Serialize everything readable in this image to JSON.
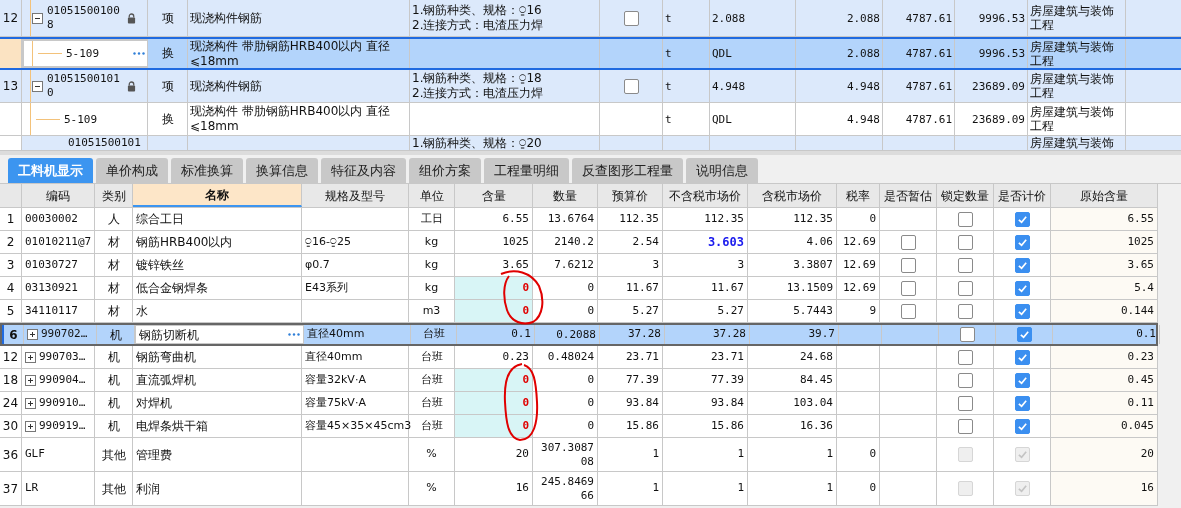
{
  "bill_rows": [
    {
      "kind": "item",
      "index": "12",
      "code": "010515001008",
      "locked": true,
      "expanded": true,
      "type": "项",
      "name": "现浇构件钢筋",
      "features": [
        "1.钢筋种类、规格：⍜16",
        "2.连接方式：电渣压力焊"
      ],
      "checked": false,
      "unit": "t",
      "expression": "2.088",
      "quantity": "2.088",
      "unit_price": "4787.61",
      "total": "9996.53",
      "specialty": "房屋建筑与装饰工程",
      "selected": false
    },
    {
      "kind": "sub",
      "code": "5-109",
      "type": "换",
      "name": "现浇构件 带肋钢筋HRB400以内 直径⩽18mm",
      "unit": "t",
      "expression": "QDL",
      "quantity": "2.088",
      "unit_price": "4787.61",
      "total": "9996.53",
      "specialty": "房屋建筑与装饰工程",
      "selected": true
    },
    {
      "kind": "item",
      "index": "13",
      "code": "010515001010",
      "locked": true,
      "expanded": true,
      "type": "项",
      "name": "现浇构件钢筋",
      "features": [
        "1.钢筋种类、规格：⍜18",
        "2.连接方式：电渣压力焊"
      ],
      "checked": false,
      "unit": "t",
      "expression": "4.948",
      "quantity": "4.948",
      "unit_price": "4787.61",
      "total": "23689.09",
      "specialty": "房屋建筑与装饰工程",
      "selected": false
    },
    {
      "kind": "sub",
      "code": "5-109",
      "type": "换",
      "name": "现浇构件 带肋钢筋HRB400以内 直径⩽18mm",
      "unit": "t",
      "expression": "QDL",
      "quantity": "4.948",
      "unit_price": "4787.61",
      "total": "23689.09",
      "specialty": "房屋建筑与装饰工程",
      "selected": false
    },
    {
      "kind": "partial",
      "code": "01051500101",
      "features": [
        "1.钢筋种类、规格：⍜20"
      ],
      "specialty": "房屋建筑与装饰"
    }
  ],
  "tabs": [
    {
      "label": "工料机显示",
      "selected": true
    },
    {
      "label": "单价构成",
      "selected": false
    },
    {
      "label": "标准换算",
      "selected": false
    },
    {
      "label": "换算信息",
      "selected": false
    },
    {
      "label": "特征及内容",
      "selected": false
    },
    {
      "label": "组价方案",
      "selected": false
    },
    {
      "label": "工程量明细",
      "selected": false
    },
    {
      "label": "反查图形工程量",
      "selected": false
    },
    {
      "label": "说明信息",
      "selected": false
    }
  ],
  "columns": [
    {
      "label": "编码",
      "active": false
    },
    {
      "label": "类别",
      "active": false
    },
    {
      "label": "名称",
      "active": true
    },
    {
      "label": "规格及型号",
      "active": false
    },
    {
      "label": "单位",
      "active": false
    },
    {
      "label": "含量",
      "active": false
    },
    {
      "label": "数量",
      "active": false
    },
    {
      "label": "预算价",
      "active": false
    },
    {
      "label": "不含税市场价",
      "active": false
    },
    {
      "label": "含税市场价",
      "active": false
    },
    {
      "label": "税率",
      "active": false
    },
    {
      "label": "是否暂估",
      "active": false
    },
    {
      "label": "锁定数量",
      "active": false
    },
    {
      "label": "是否计价",
      "active": false
    },
    {
      "label": "原始含量",
      "active": false
    }
  ],
  "resources": [
    {
      "index": "1",
      "code": "00030002",
      "expandable": false,
      "type": "人",
      "name": "综合工日",
      "unit": "工日",
      "content": "6.55",
      "content_changed": false,
      "quantity": "13.6764",
      "budget_price": "112.35",
      "market_price": "112.35",
      "market_price_adjusted": false,
      "tax_price": "112.35",
      "tax_rate": "0",
      "locked": false,
      "priced": true,
      "disabled": false,
      "original_content": "6.55",
      "selected": false
    },
    {
      "index": "2",
      "code": "01010211@7",
      "expandable": false,
      "type": "材",
      "name": "钢筋HRB400以内",
      "spec": "⍜16-⍜25",
      "unit": "kg",
      "content": "1025",
      "content_changed": false,
      "quantity": "2140.2",
      "budget_price": "2.54",
      "market_price": "3.603",
      "market_price_adjusted": true,
      "tax_price": "4.06",
      "tax_rate": "12.69",
      "provisional": false,
      "locked": false,
      "priced": true,
      "disabled": false,
      "original_content": "1025",
      "selected": false
    },
    {
      "index": "3",
      "code": "01030727",
      "expandable": false,
      "type": "材",
      "name": "镀锌铁丝",
      "spec": "φ0.7",
      "unit": "kg",
      "content": "3.65",
      "content_changed": false,
      "quantity": "7.6212",
      "budget_price": "3",
      "market_price": "3",
      "market_price_adjusted": false,
      "tax_price": "3.3807",
      "tax_rate": "12.69",
      "provisional": false,
      "locked": false,
      "priced": true,
      "disabled": false,
      "original_content": "3.65",
      "selected": false
    },
    {
      "index": "4",
      "code": "03130921",
      "expandable": false,
      "type": "材",
      "name": "低合金钢焊条",
      "spec": "E43系列",
      "unit": "kg",
      "content": "0",
      "content_changed": true,
      "quantity": "0",
      "budget_price": "11.67",
      "market_price": "11.67",
      "market_price_adjusted": false,
      "tax_price": "13.1509",
      "tax_rate": "12.69",
      "provisional": false,
      "locked": false,
      "priced": true,
      "disabled": false,
      "original_content": "5.4",
      "selected": false
    },
    {
      "index": "5",
      "code": "34110117",
      "expandable": false,
      "type": "材",
      "name": "水",
      "unit": "m3",
      "content": "0",
      "content_changed": true,
      "quantity": "0",
      "budget_price": "5.27",
      "market_price": "5.27",
      "market_price_adjusted": false,
      "tax_price": "5.7443",
      "tax_rate": "9",
      "provisional": false,
      "locked": false,
      "priced": true,
      "disabled": false,
      "original_content": "0.144",
      "selected": false
    },
    {
      "index": "6",
      "code": "990702…",
      "expandable": true,
      "type": "机",
      "name": "钢筋切断机",
      "spec": "直径40mm",
      "unit": "台班",
      "content": "0.1",
      "content_changed": false,
      "quantity": "0.2088",
      "budget_price": "37.28",
      "market_price": "37.28",
      "market_price_adjusted": false,
      "tax_price": "39.7",
      "locked": false,
      "priced": true,
      "disabled": false,
      "original_content": "0.1",
      "selected": true
    },
    {
      "index": "12",
      "code": "990703…",
      "expandable": true,
      "type": "机",
      "name": "钢筋弯曲机",
      "spec": "直径40mm",
      "unit": "台班",
      "content": "0.23",
      "content_changed": false,
      "quantity": "0.48024",
      "budget_price": "23.71",
      "market_price": "23.71",
      "market_price_adjusted": false,
      "tax_price": "24.68",
      "locked": false,
      "priced": true,
      "disabled": false,
      "original_content": "0.23",
      "selected": false
    },
    {
      "index": "18",
      "code": "990904…",
      "expandable": true,
      "type": "机",
      "name": "直流弧焊机",
      "spec": "容量32kV·A",
      "unit": "台班",
      "content": "0",
      "content_changed": true,
      "quantity": "0",
      "budget_price": "77.39",
      "market_price": "77.39",
      "market_price_adjusted": false,
      "tax_price": "84.45",
      "locked": false,
      "priced": true,
      "disabled": false,
      "original_content": "0.45",
      "selected": false
    },
    {
      "index": "24",
      "code": "990910…",
      "expandable": true,
      "type": "机",
      "name": "对焊机",
      "spec": "容量75kV·A",
      "unit": "台班",
      "content": "0",
      "content_changed": true,
      "quantity": "0",
      "budget_price": "93.84",
      "market_price": "93.84",
      "market_price_adjusted": false,
      "tax_price": "103.04",
      "locked": false,
      "priced": true,
      "disabled": false,
      "original_content": "0.11",
      "selected": false
    },
    {
      "index": "30",
      "code": "990919…",
      "expandable": true,
      "type": "机",
      "name": "电焊条烘干箱",
      "spec": "容量45×35×45cm3",
      "unit": "台班",
      "content": "0",
      "content_changed": true,
      "quantity": "0",
      "budget_price": "15.86",
      "market_price": "15.86",
      "market_price_adjusted": false,
      "tax_price": "16.36",
      "locked": false,
      "priced": true,
      "disabled": false,
      "original_content": "0.045",
      "selected": false
    },
    {
      "index": "36",
      "code": "GLF",
      "expandable": false,
      "type": "其他",
      "name": "管理费",
      "unit": "%",
      "content": "20",
      "content_changed": false,
      "quantity": "307.308708",
      "budget_price": "1",
      "market_price": "1",
      "market_price_adjusted": false,
      "tax_price": "1",
      "tax_rate": "0",
      "locked": false,
      "priced": true,
      "disabled": true,
      "original_content": "20",
      "selected": false
    },
    {
      "index": "37",
      "code": "LR",
      "expandable": false,
      "type": "其他",
      "name": "利润",
      "unit": "%",
      "content": "16",
      "content_changed": false,
      "quantity": "245.846966",
      "budget_price": "1",
      "market_price": "1",
      "market_price_adjusted": false,
      "tax_price": "1",
      "tax_rate": "0",
      "locked": false,
      "priced": true,
      "disabled": true,
      "original_content": "16",
      "selected": false
    }
  ]
}
